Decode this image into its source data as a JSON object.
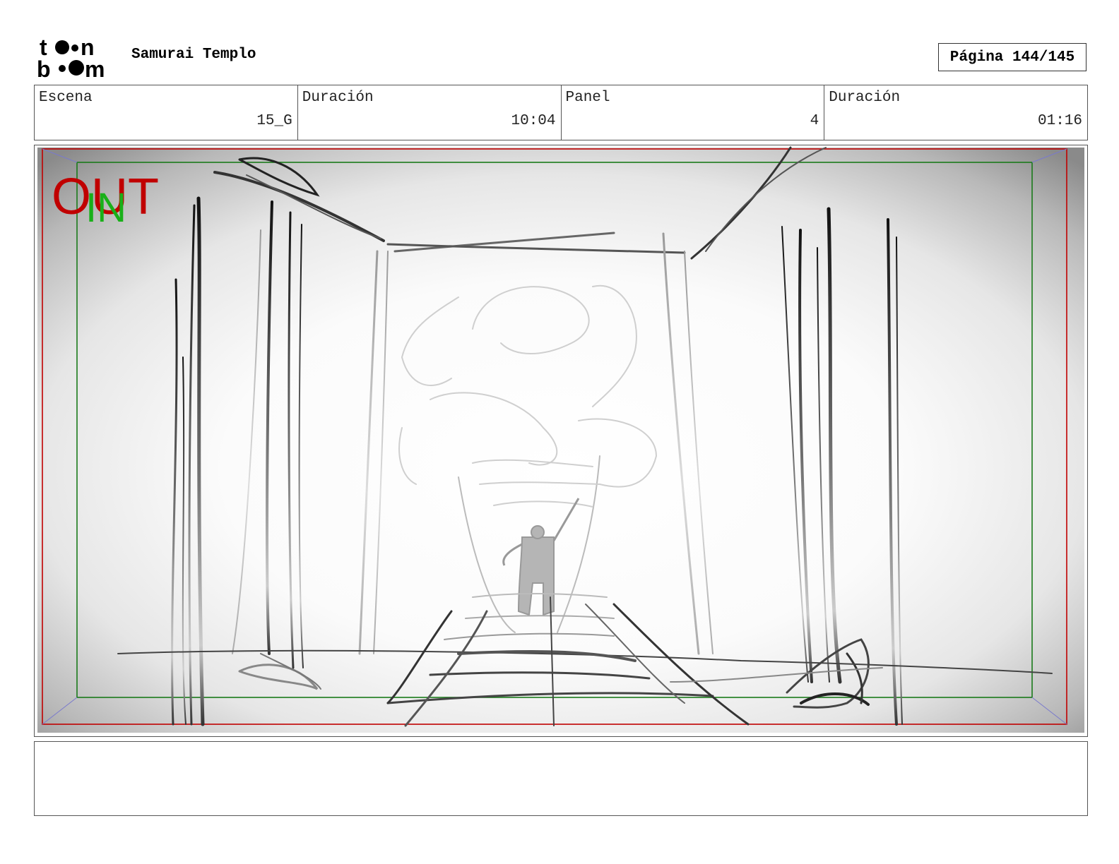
{
  "header": {
    "logo_top": "t••n",
    "logo_bottom": "b••m",
    "project_title": "Samurai Templo",
    "page_label": "Página 144/145"
  },
  "info": {
    "scene_label": "Escena",
    "scene_value": "15_G",
    "scene_duration_label": "Duración",
    "scene_duration_value": "10:04",
    "panel_label": "Panel",
    "panel_value": "4",
    "panel_duration_label": "Duración",
    "panel_duration_value": "01:16"
  },
  "frame": {
    "out_label": "OUT",
    "in_label": "IN",
    "out_color": "#c00000",
    "in_color": "#19b019",
    "safe_area_color": "#1a7a1a"
  },
  "notes": {
    "text": ""
  }
}
